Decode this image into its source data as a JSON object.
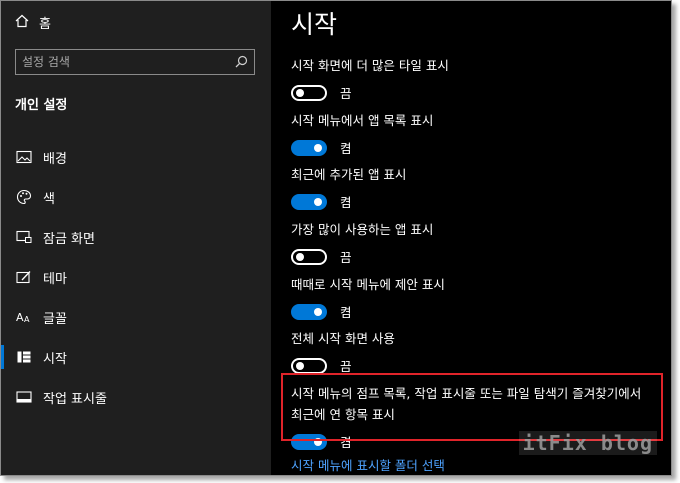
{
  "sidebar": {
    "home_label": "홈",
    "search_placeholder": "설정 검색",
    "section_title": "개인 설정",
    "items": [
      {
        "label": "배경",
        "icon": "picture-icon"
      },
      {
        "label": "색",
        "icon": "palette-icon"
      },
      {
        "label": "잠금 화면",
        "icon": "lock-screen-icon"
      },
      {
        "label": "테마",
        "icon": "theme-icon"
      },
      {
        "label": "글꼴",
        "icon": "fonts-icon"
      },
      {
        "label": "시작",
        "icon": "start-icon",
        "active": true
      },
      {
        "label": "작업 표시줄",
        "icon": "taskbar-icon"
      }
    ]
  },
  "main": {
    "title": "시작",
    "settings": [
      {
        "label": "시작 화면에 더 많은 타일 표시",
        "on": false,
        "state": "끔"
      },
      {
        "label": "시작 메뉴에서 앱 목록 표시",
        "on": true,
        "state": "켬"
      },
      {
        "label": "최근에 추가된 앱 표시",
        "on": true,
        "state": "켬"
      },
      {
        "label": "가장 많이 사용하는 앱 표시",
        "on": false,
        "state": "끔"
      },
      {
        "label": "때때로 시작 메뉴에 제안 표시",
        "on": true,
        "state": "켬"
      },
      {
        "label": "전체 시작 화면 사용",
        "on": false,
        "state": "끔"
      },
      {
        "label": "시작 메뉴의 점프 목록, 작업 표시줄 또는 파일 탐색기 즐겨찾기에서",
        "label2": "최근에 연 항목 표시",
        "on": true,
        "state": "켬"
      }
    ],
    "link": "시작 메뉴에 표시할 폴더 선택"
  },
  "watermark": "itFix blog",
  "colors": {
    "accent": "#0078d7",
    "highlight": "#e0242a",
    "link": "#4ea3ff"
  }
}
